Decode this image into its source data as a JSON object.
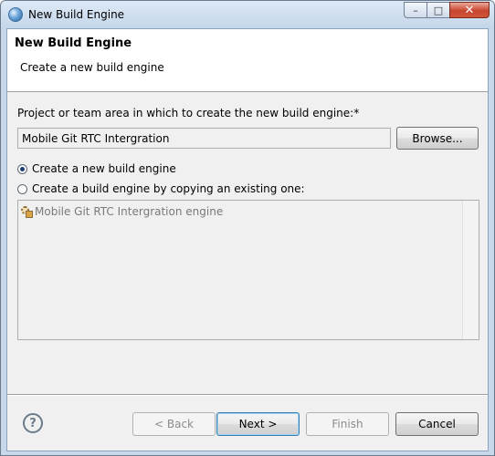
{
  "window": {
    "title": "New Build Engine",
    "minimize_glyph": "–",
    "maximize_glyph": "□",
    "close_glyph": "✕"
  },
  "header": {
    "title": "New Build Engine",
    "description": "Create a new build engine"
  },
  "form": {
    "project_label": "Project or team area in which to create the new build engine:*",
    "project_value": "Mobile Git RTC Intergration",
    "browse_label": "Browse...",
    "radio_new_label": "Create a new build engine",
    "radio_new_selected": true,
    "radio_copy_label": "Create a build engine by copying an existing one:",
    "radio_copy_selected": false,
    "engines": [
      {
        "name": "Mobile Git RTC Intergration engine",
        "icon": "build-engine-icon"
      }
    ]
  },
  "footer": {
    "help_glyph": "?",
    "back_label": "< Back",
    "next_label": "Next >",
    "finish_label": "Finish",
    "cancel_label": "Cancel"
  }
}
